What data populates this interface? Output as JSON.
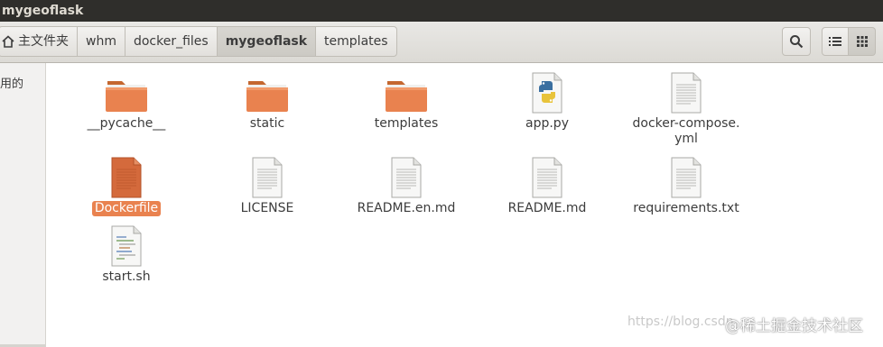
{
  "window": {
    "title": "mygeoflask"
  },
  "breadcrumb": {
    "home_label": "主文件夹",
    "items": [
      {
        "label": "whm",
        "active": false
      },
      {
        "label": "docker_files",
        "active": false
      },
      {
        "label": "mygeoflask",
        "active": true
      },
      {
        "label": "templates",
        "active": false
      }
    ]
  },
  "sidebar": {
    "partial_text": "用的"
  },
  "files": [
    {
      "name": "__pycache__",
      "type": "folder"
    },
    {
      "name": "static",
      "type": "folder"
    },
    {
      "name": "templates",
      "type": "folder"
    },
    {
      "name": "app.py",
      "type": "python"
    },
    {
      "name": "docker-compose.\nyml",
      "type": "text"
    },
    {
      "name": "Dockerfile",
      "type": "dockerfile",
      "selected": true
    },
    {
      "name": "LICENSE",
      "type": "text"
    },
    {
      "name": "README.en.md",
      "type": "text"
    },
    {
      "name": "README.md",
      "type": "text"
    },
    {
      "name": "requirements.txt",
      "type": "text"
    },
    {
      "name": "start.sh",
      "type": "script"
    }
  ],
  "watermark": {
    "url": "https://blog.csdn",
    "brand": "@稀土掘金技术社区"
  },
  "colors": {
    "folder": "#e9824f",
    "selection": "#e9824f",
    "titlebar": "#2f2e2b"
  }
}
